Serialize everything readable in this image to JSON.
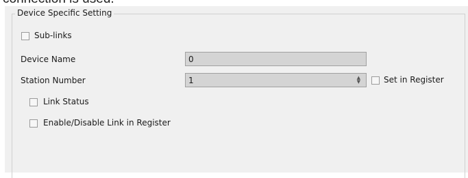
{
  "header_fragment": "connection is used.",
  "group": {
    "title": "Device Specific Setting"
  },
  "sub_links": {
    "label": "Sub-links",
    "checked": false
  },
  "device_name": {
    "label": "Device Name",
    "value": "0"
  },
  "station_number": {
    "label": "Station Number",
    "value": "1",
    "set_in_register": {
      "label": "Set in Register",
      "checked": false
    }
  },
  "link_status": {
    "label": "Link Status",
    "checked": false
  },
  "enable_disable_link": {
    "label": "Enable/Disable Link in Register",
    "checked": false
  }
}
